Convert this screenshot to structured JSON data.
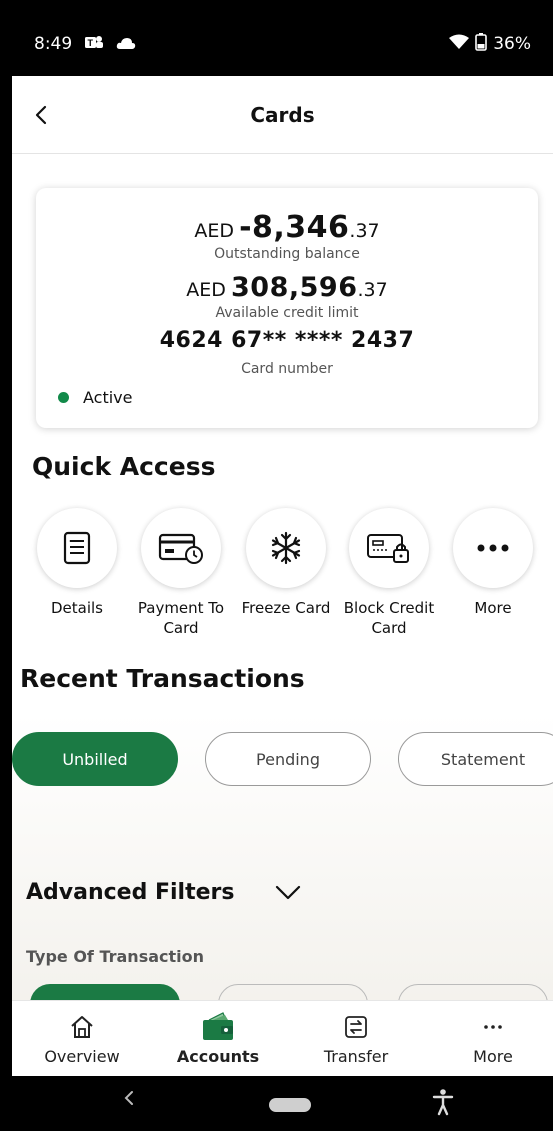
{
  "status_bar": {
    "time": "8:49",
    "battery": "36%"
  },
  "header": {
    "title": "Cards"
  },
  "card_summary": {
    "outstanding": {
      "currency": "AED",
      "whole": "-8,346",
      "decimal": ".37",
      "caption": "Outstanding balance"
    },
    "available": {
      "currency": "AED",
      "whole": "308,596",
      "decimal": ".37",
      "caption": "Available credit limit"
    },
    "card_number": {
      "value": "4624 67** **** 2437",
      "caption": "Card number"
    },
    "status": "Active"
  },
  "quick_access": {
    "title": "Quick Access",
    "items": [
      {
        "label": "Details",
        "icon": "details-icon"
      },
      {
        "label": "Payment To Card",
        "icon": "payment-card-icon"
      },
      {
        "label": "Freeze Card",
        "icon": "snowflake-icon"
      },
      {
        "label": "Block Credit Card",
        "icon": "lock-card-icon"
      },
      {
        "label": "More",
        "icon": "more-dots-icon"
      }
    ]
  },
  "recent_transactions": {
    "title": "Recent Transactions",
    "tabs": [
      {
        "label": "Unbilled",
        "active": true
      },
      {
        "label": "Pending",
        "active": false
      },
      {
        "label": "Statement",
        "active": false
      }
    ]
  },
  "advanced_filters": {
    "title": "Advanced Filters",
    "type_label": "Type Of Transaction"
  },
  "bottom_nav": {
    "items": [
      {
        "label": "Overview",
        "icon": "home-icon",
        "active": false
      },
      {
        "label": "Accounts",
        "icon": "wallet-icon",
        "active": true
      },
      {
        "label": "Transfer",
        "icon": "transfer-icon",
        "active": false
      },
      {
        "label": "More",
        "icon": "more-dots-icon",
        "active": false
      }
    ]
  },
  "colors": {
    "brand_green": "#1b7a44",
    "active_dot": "#128a4a"
  }
}
